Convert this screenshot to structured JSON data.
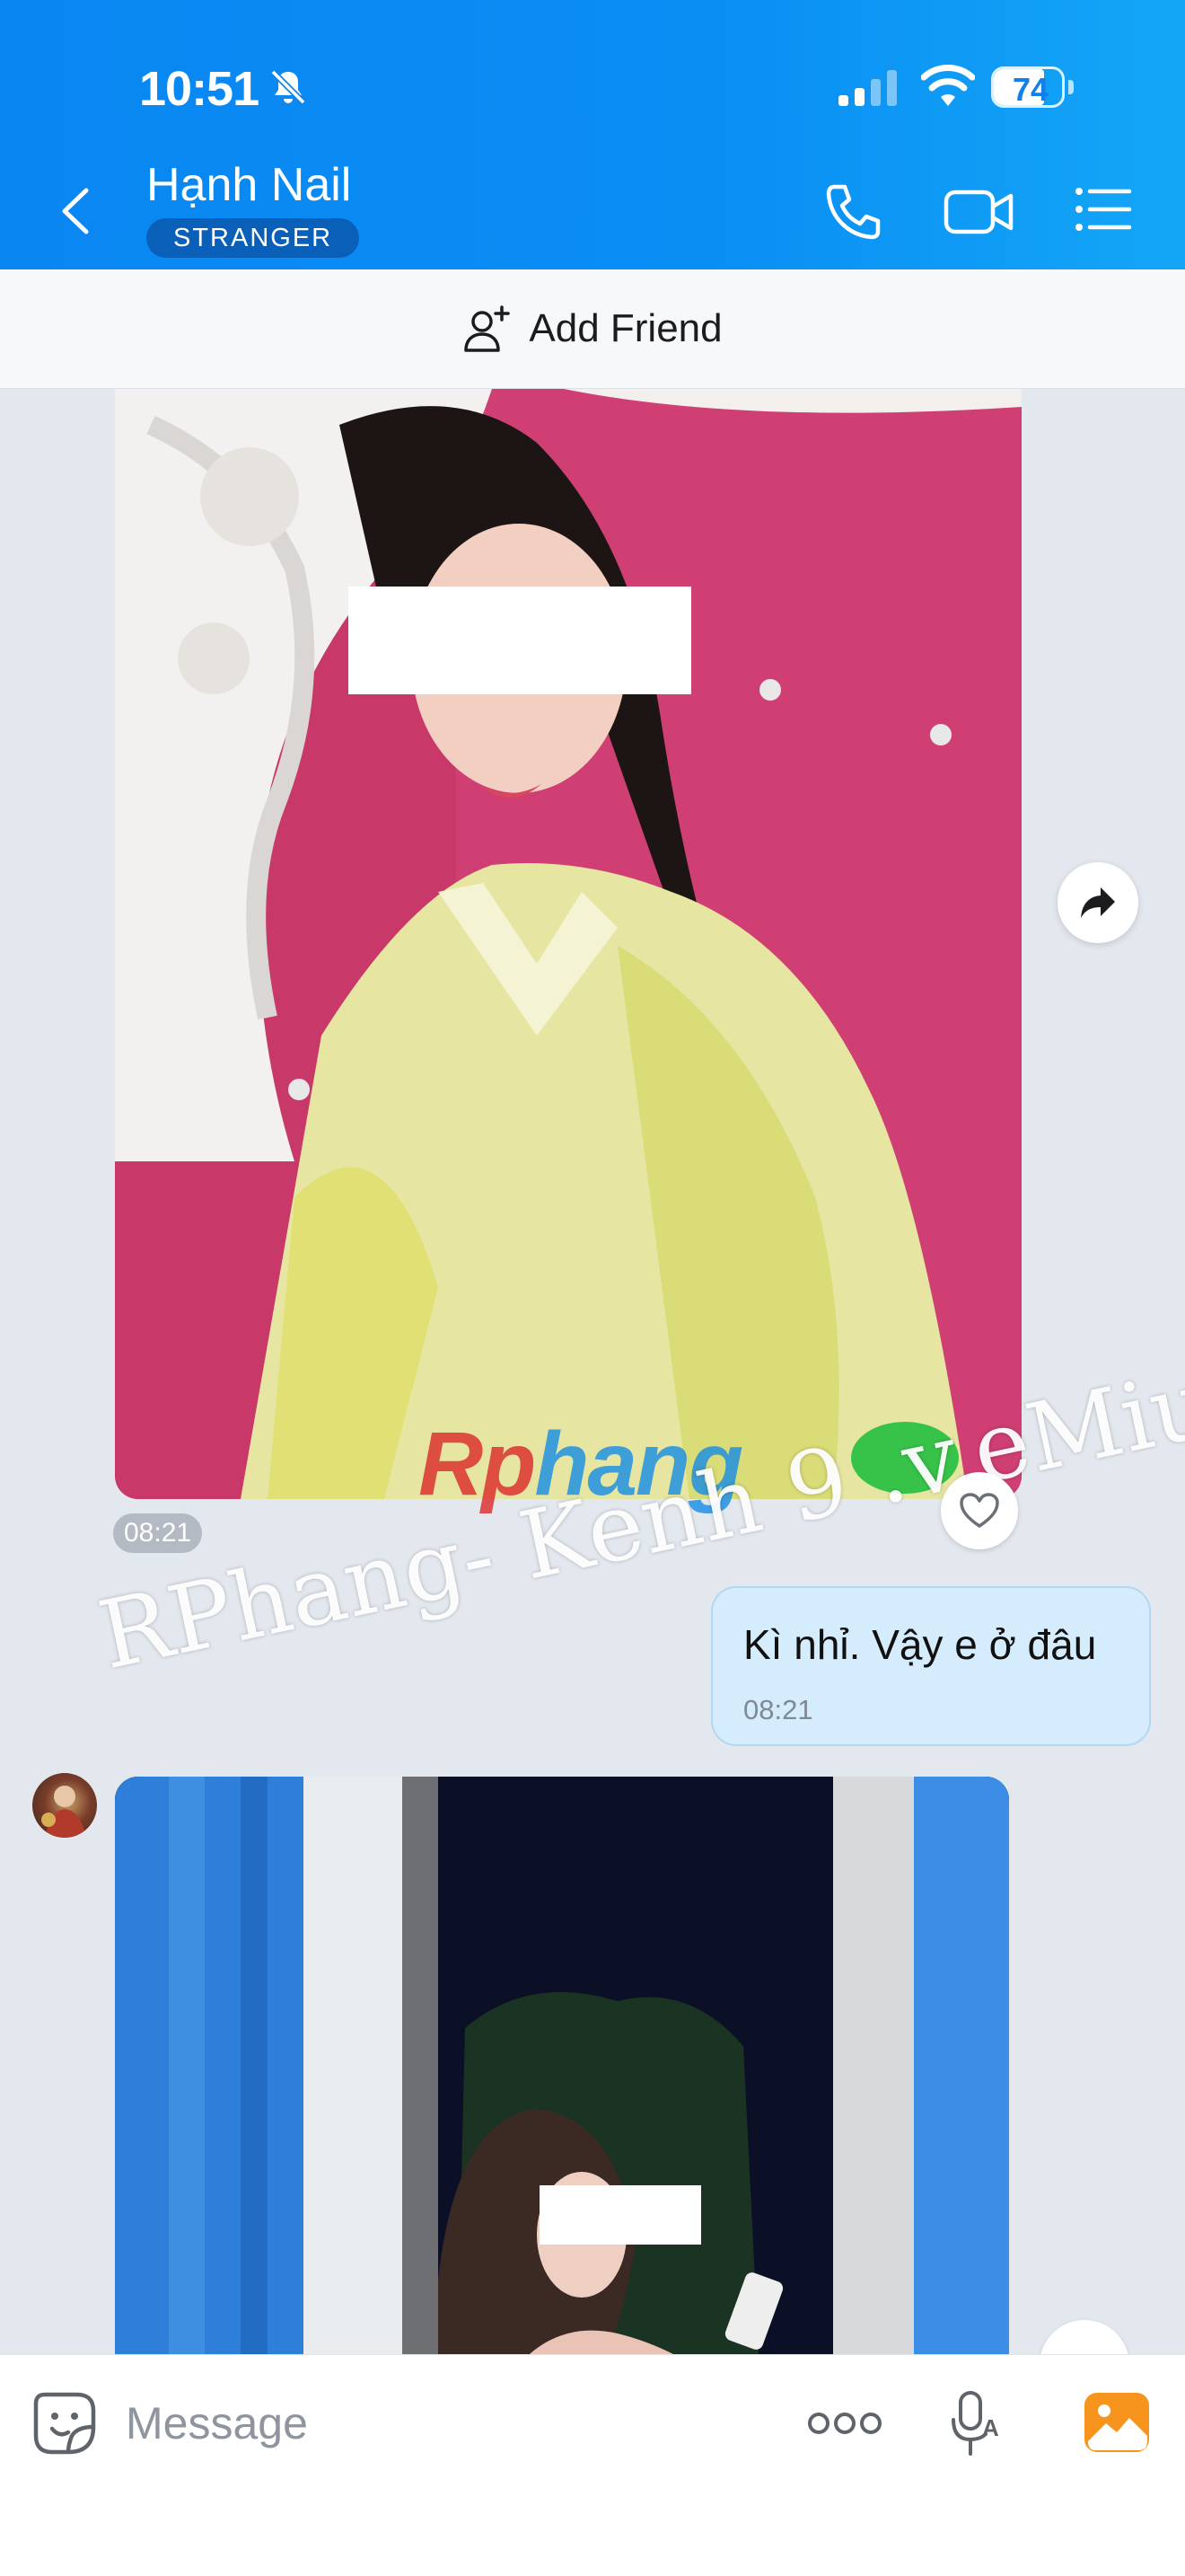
{
  "status_bar": {
    "time": "10:51",
    "battery": "74",
    "battery_level": 0.74,
    "icons": [
      "bell-slash-icon",
      "signal-icon",
      "wifi-icon",
      "battery-icon"
    ]
  },
  "header": {
    "name": "Hạnh Nail",
    "badge": "STRANGER",
    "icons": [
      "chevron-left-icon",
      "phone-icon",
      "video-camera-icon",
      "list-menu-icon"
    ]
  },
  "add_friend": {
    "label": "Add Friend",
    "icon": "person-add-icon"
  },
  "messages": [
    {
      "type": "image",
      "direction": "incoming",
      "time": "08:21",
      "watermark": "RPhang- Kenh 9 .v.eMiu"
    },
    {
      "type": "text",
      "direction": "outgoing",
      "text": "Kì nhỉ. Vậy e ở đâu",
      "time": "08:21"
    },
    {
      "type": "image",
      "direction": "incoming"
    }
  ],
  "composer": {
    "placeholder": "Message",
    "icons": [
      "sticker-icon",
      "more-dots-icon",
      "voice-text-icon",
      "image-icon"
    ]
  },
  "colors": {
    "header": "#0a8ef4",
    "badge": "#0a5fb8",
    "outgoing_bubble": "#d4ecfc",
    "chat_background": "#e3e8ef",
    "image_button": "#f7941e"
  }
}
